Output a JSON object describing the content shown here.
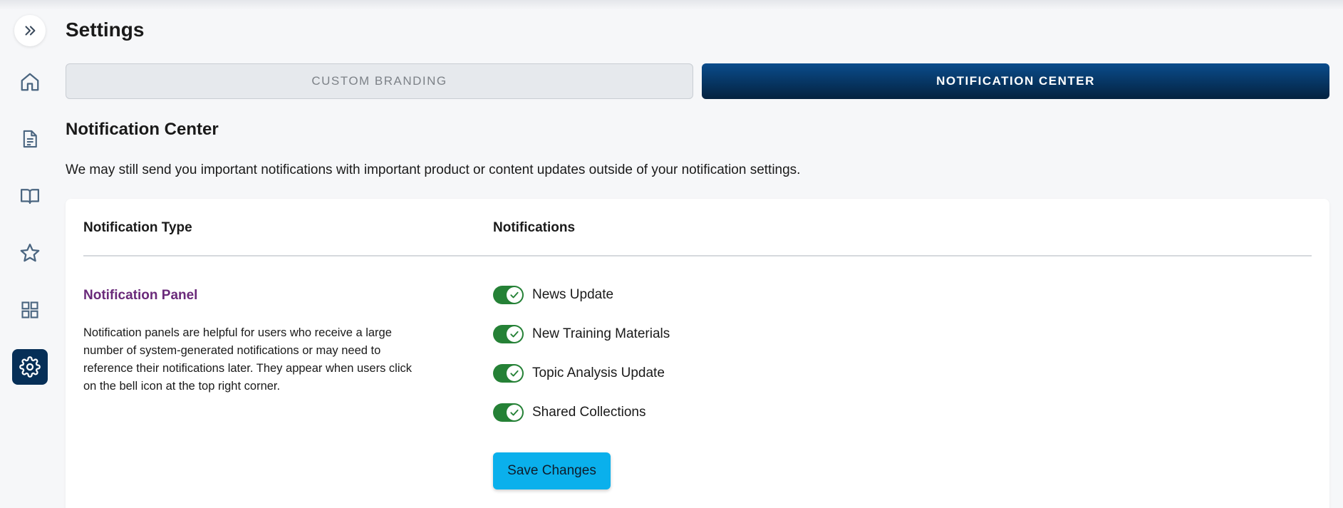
{
  "header": {
    "title": "Settings"
  },
  "sidebar": {
    "items": [
      {
        "icon": "home-icon"
      },
      {
        "icon": "document-icon"
      },
      {
        "icon": "book-icon"
      },
      {
        "icon": "star-icon"
      },
      {
        "icon": "grid-icon"
      },
      {
        "icon": "gear-icon",
        "active": true
      }
    ]
  },
  "tabs": [
    {
      "label": "CUSTOM BRANDING",
      "active": false
    },
    {
      "label": "NOTIFICATION CENTER",
      "active": true
    }
  ],
  "section": {
    "title": "Notification Center",
    "description": "We may still send you important notifications with important product or content updates outside of your notification settings."
  },
  "table": {
    "headers": [
      "Notification Type",
      "Notifications"
    ],
    "panel": {
      "title": "Notification Panel",
      "description": "Notification panels are helpful for users who receive a large number of system-generated notifications or may need to reference their notifications later. They appear when users click on the bell icon at the top right corner."
    },
    "toggles": [
      {
        "label": "News Update",
        "on": true
      },
      {
        "label": "New Training Materials",
        "on": true
      },
      {
        "label": "Topic Analysis Update",
        "on": true
      },
      {
        "label": "Shared Collections",
        "on": true
      }
    ]
  },
  "actions": {
    "save_label": "Save Changes"
  },
  "colors": {
    "accent_navy": "#062f57",
    "toggle_green": "#258136",
    "save_blue": "#0ab0ec",
    "panel_title_purple": "#6a2a7a"
  }
}
